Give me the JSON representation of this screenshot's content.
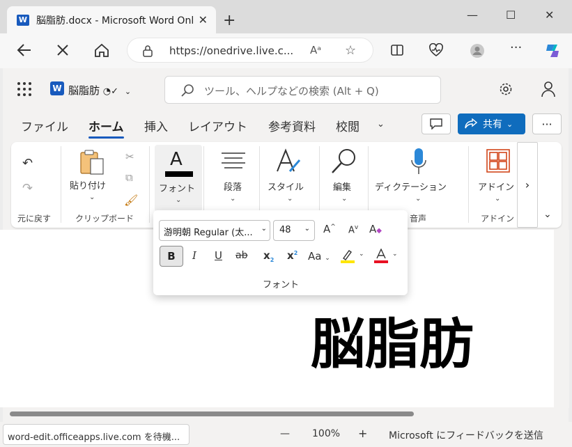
{
  "browser": {
    "tab_title": "脳脂肪.docx - Microsoft Word Onl",
    "new_tab_symbol": "+",
    "url": "https://onedrive.live.c...",
    "read_aloud": "A",
    "hover_link": "word-edit.officeapps.live.com を待機..."
  },
  "app": {
    "doc_name": "脳脂肪",
    "search_placeholder": "ツール、ヘルプなどの検索 (Alt + Q)",
    "menu_tabs": [
      "ファイル",
      "ホーム",
      "挿入",
      "レイアウト",
      "参考資料",
      "校閲"
    ],
    "share_label": "共有",
    "accent": "#185abd",
    "share_color": "#0f6cbd"
  },
  "ribbon": {
    "undo_caption": "元に戻す",
    "paste_label": "貼り付け",
    "clipboard_caption": "クリップボード",
    "font_label": "フォント",
    "paragraph_label": "段落",
    "styles_label": "スタイル",
    "editing_label": "編集",
    "dictate_label": "ディクテーション",
    "dictate_caption": "音声",
    "addins_label": "アドイン",
    "addins_caption": "アドイン"
  },
  "font_panel": {
    "font_name": "游明朝 Regular (太...",
    "font_size": "48",
    "caption": "フォント",
    "bold": "B",
    "italic": "I",
    "underline": "U",
    "strike": "ab",
    "subscript": "x",
    "superscript": "x",
    "case": "Aa",
    "highlight_color": "#ffe600",
    "font_color": "#e81123"
  },
  "document": {
    "heading": "脳脂肪"
  },
  "status": {
    "zoom": "100%",
    "zoom_out": "—",
    "zoom_in": "+",
    "feedback": "Microsoft にフィードバックを送信"
  }
}
